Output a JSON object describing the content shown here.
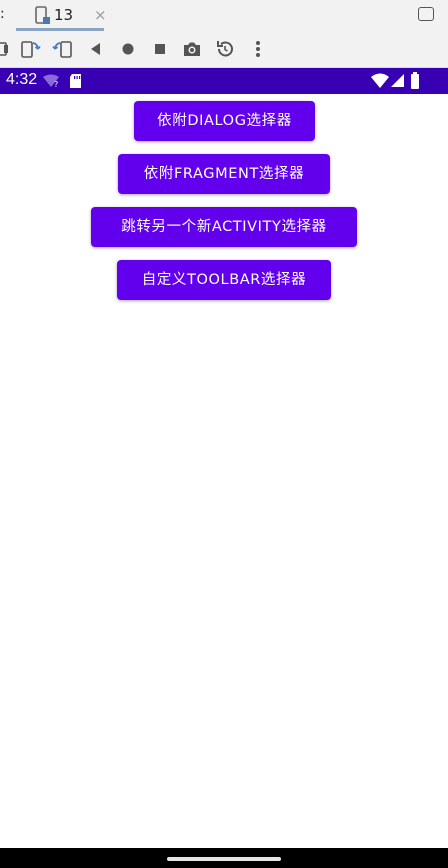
{
  "ide": {
    "tab_prefix": ":",
    "tab_label": "13",
    "tab_close": "×"
  },
  "toolbar": {
    "icons": [
      "sidebar-toggle-icon",
      "rotate-left-icon",
      "rotate-right-icon",
      "back-icon",
      "home-icon",
      "overview-icon",
      "screenshot-icon",
      "snapshot-history-icon",
      "more-options-icon"
    ]
  },
  "statusbar": {
    "time": "4:32"
  },
  "app": {
    "buttons": [
      {
        "label": "依附DIALOG选择器"
      },
      {
        "label": "依附FRAGMENT选择器"
      },
      {
        "label": "跳转另一个新ACTIVITY选择器"
      },
      {
        "label": "自定义TOOLBAR选择器"
      }
    ]
  },
  "colors": {
    "primary": "#6200ee",
    "status_bar": "#3700b3"
  }
}
